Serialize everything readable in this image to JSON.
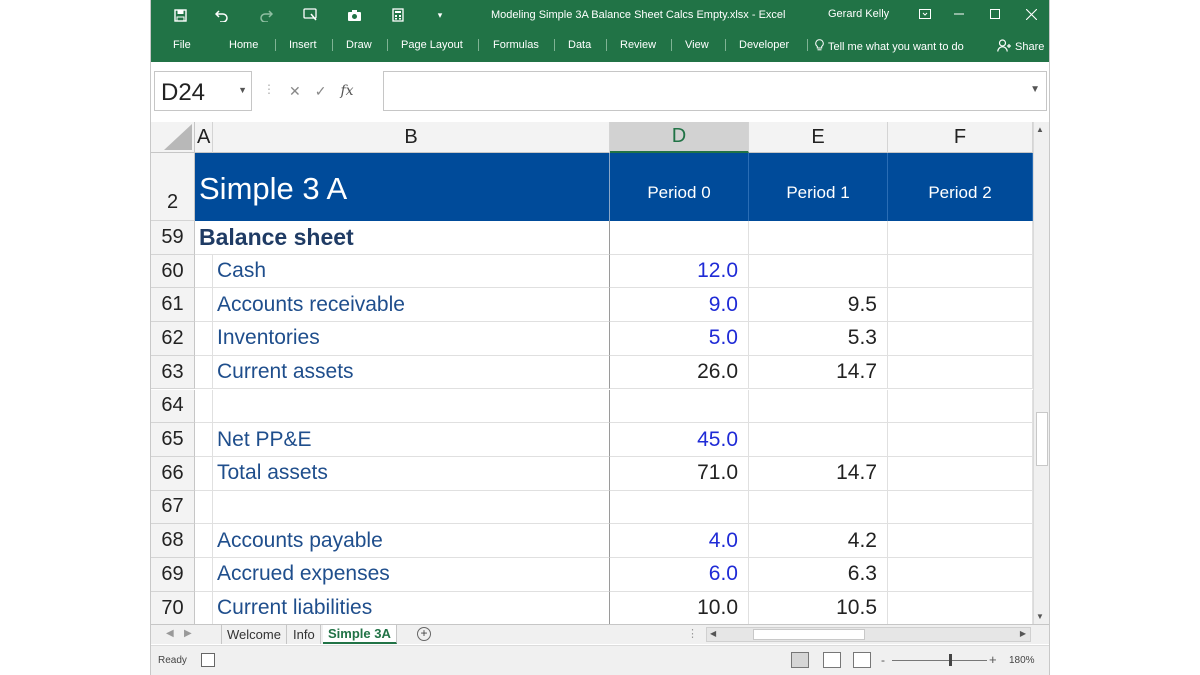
{
  "window": {
    "title": "Modeling Simple 3A Balance Sheet Calcs Empty.xlsx  -  Excel",
    "user": "Gerard Kelly"
  },
  "ribbon": {
    "tabs": [
      "File",
      "Home",
      "Insert",
      "Draw",
      "Page Layout",
      "Formulas",
      "Data",
      "Review",
      "View",
      "Developer"
    ],
    "tell_me": "Tell me what you want to do",
    "share": "Share"
  },
  "formula_bar": {
    "name_box": "D24",
    "fx": "fx",
    "value": ""
  },
  "columns": [
    "A",
    "B",
    "D",
    "E",
    "F"
  ],
  "header": {
    "row_number": "2",
    "title": "Simple 3 A",
    "periods": [
      "Period 0",
      "Period 1",
      "Period 2"
    ]
  },
  "rows": [
    {
      "num": "59",
      "label": "Balance sheet",
      "d": "",
      "e": "",
      "f": "",
      "style": "section"
    },
    {
      "num": "60",
      "label": "Cash",
      "d": "12.0",
      "e": "",
      "f": "",
      "d_input": true
    },
    {
      "num": "61",
      "label": "Accounts receivable",
      "d": "9.0",
      "e": "9.5",
      "f": "",
      "d_input": true
    },
    {
      "num": "62",
      "label": "Inventories",
      "d": "5.0",
      "e": "5.3",
      "f": "",
      "d_input": true
    },
    {
      "num": "63",
      "label": "Current assets",
      "d": "26.0",
      "e": "14.7",
      "f": "",
      "d_input": false
    },
    {
      "num": "64",
      "label": "",
      "d": "",
      "e": "",
      "f": "",
      "d_input": false
    },
    {
      "num": "65",
      "label": "Net PP&E",
      "d": "45.0",
      "e": "",
      "f": "",
      "d_input": true
    },
    {
      "num": "66",
      "label": "Total assets",
      "d": "71.0",
      "e": "14.7",
      "f": "",
      "d_input": false
    },
    {
      "num": "67",
      "label": "",
      "d": "",
      "e": "",
      "f": "",
      "d_input": false
    },
    {
      "num": "68",
      "label": "Accounts payable",
      "d": "4.0",
      "e": "4.2",
      "f": "",
      "d_input": true
    },
    {
      "num": "69",
      "label": "Accrued expenses",
      "d": "6.0",
      "e": "6.3",
      "f": "",
      "d_input": true
    },
    {
      "num": "70",
      "label": "Current liabilities",
      "d": "10.0",
      "e": "10.5",
      "f": "",
      "d_input": false
    }
  ],
  "sheets": {
    "tabs": [
      "Welcome",
      "Info",
      "Simple 3A"
    ],
    "active": "Simple 3A"
  },
  "status": {
    "text": "Ready",
    "zoom": "180%"
  },
  "colors": {
    "excel_green": "#217346",
    "header_blue": "#004b9a",
    "input_blue": "#1f2bd6",
    "label_blue": "#1f4e8c"
  },
  "icons": [
    "save-icon",
    "undo-icon",
    "redo-icon",
    "touch-mode-icon",
    "camera-icon",
    "calculator-icon",
    "customize-qat-icon",
    "ribbon-display-icon",
    "minimize-icon",
    "maximize-icon",
    "close-icon",
    "lightbulb-icon",
    "person-icon"
  ]
}
